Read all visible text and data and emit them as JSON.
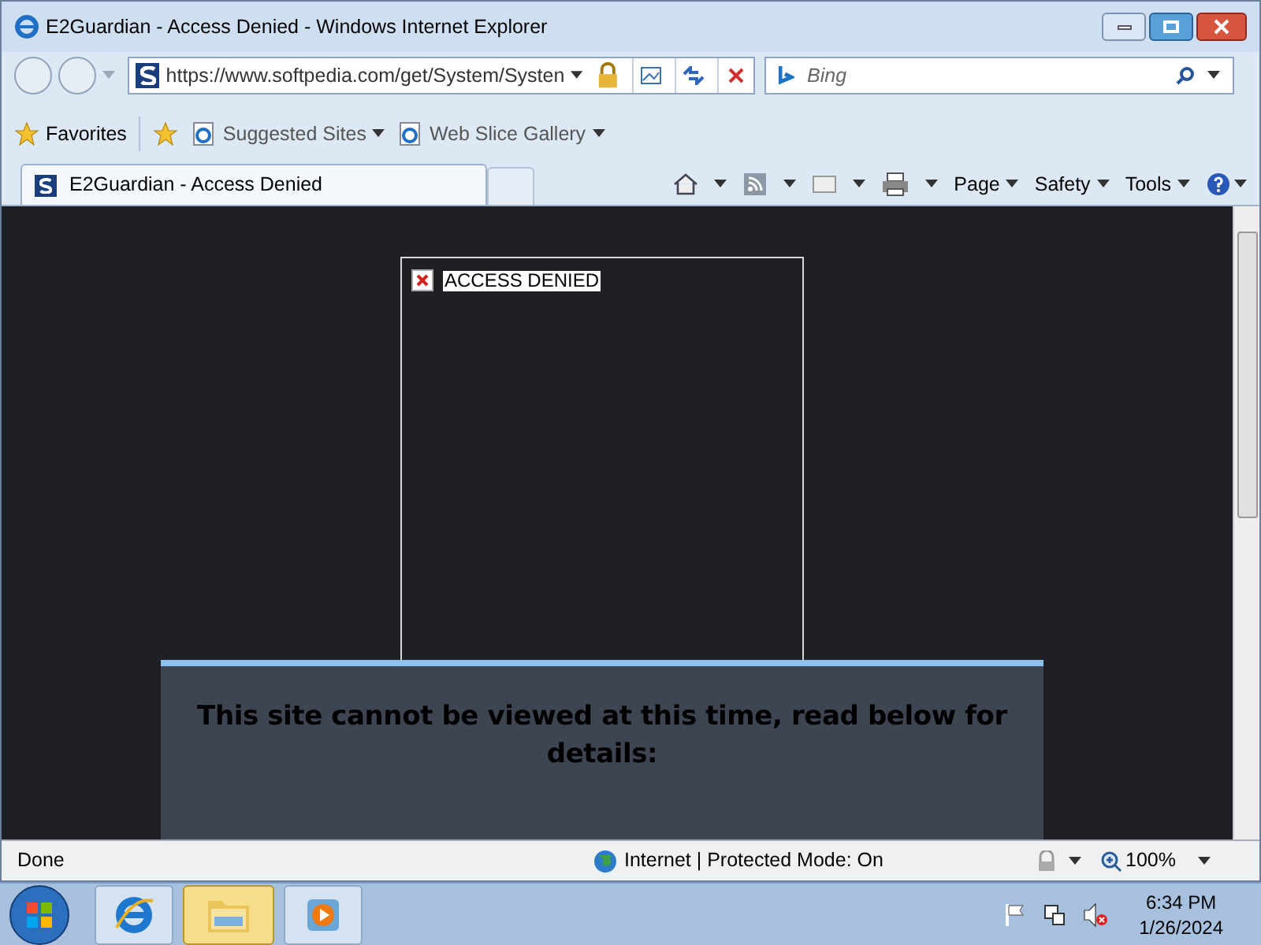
{
  "window": {
    "title": "E2Guardian - Access Denied - Windows Internet Explorer"
  },
  "address_bar": {
    "url": "https://www.softpedia.com/get/System/Systen"
  },
  "search": {
    "placeholder": "Bing"
  },
  "favorites_bar": {
    "items": [
      {
        "kind": "favorites",
        "label": "Favorites"
      },
      {
        "kind": "page",
        "label": "Suggested Sites"
      },
      {
        "kind": "page",
        "label": "Web Slice Gallery"
      }
    ]
  },
  "tab": {
    "title": "E2Guardian - Access Denied"
  },
  "command_bar": {
    "menus": [
      "Page",
      "Safety",
      "Tools"
    ]
  },
  "page": {
    "alert": "ACCESS DENIED",
    "message": "This site cannot be viewed at this time, read below for details:"
  },
  "status_bar": {
    "status": "Done",
    "zone": "Internet | Protected Mode: On",
    "zoom": "100%"
  },
  "taskbar": {
    "apps": [
      {
        "kind": "browser",
        "selected": false
      },
      {
        "kind": "folder",
        "selected": true
      },
      {
        "kind": "media",
        "selected": false
      }
    ],
    "time": "6:34 PM",
    "date": "1/26/2024"
  }
}
